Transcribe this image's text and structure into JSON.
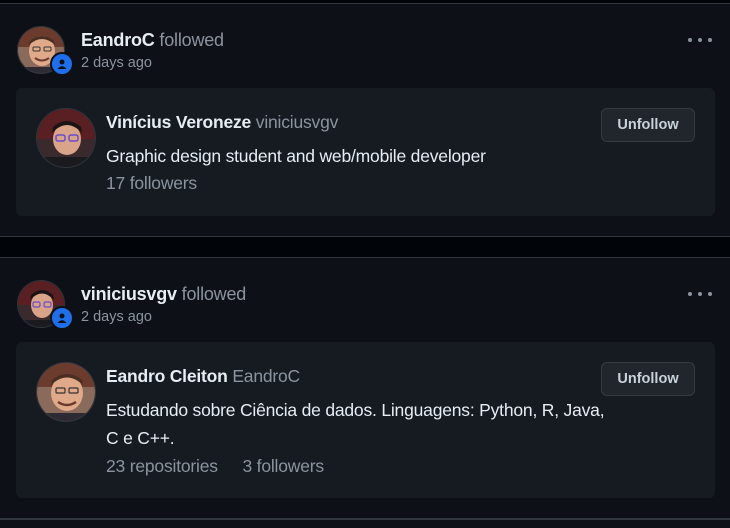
{
  "events": [
    {
      "actor": "EandroC",
      "action": "followed",
      "time": "2 days ago",
      "target": {
        "full_name": "Vinícius Veroneze",
        "login": "viniciusvgv",
        "bio": "Graphic design student and web/mobile developer",
        "followers": "17 followers",
        "button": "Unfollow"
      }
    },
    {
      "actor": "viniciusvgv",
      "action": "followed",
      "time": "2 days ago",
      "target": {
        "full_name": "Eandro Cleiton",
        "login": "EandroC",
        "bio": "Estudando sobre Ciência de dados. Linguagens: Python, R, Java, C e C++.",
        "repositories": "23 repositories",
        "followers": "3 followers",
        "button": "Unfollow"
      }
    }
  ],
  "colors": {
    "page_bg": "#010409",
    "card_bg": "#0d1117",
    "inner_bg": "#161b22",
    "badge": "#1f6feb",
    "muted": "#8b949e"
  },
  "icons": {
    "badge": "person-icon",
    "menu": "kebab-menu-icon"
  }
}
